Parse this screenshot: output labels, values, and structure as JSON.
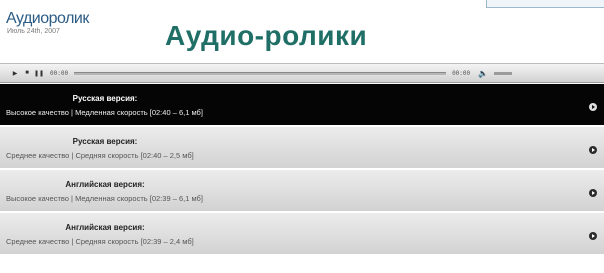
{
  "brand": {
    "title": "Аудиоролик",
    "subtitle": "Июль 24th, 2007"
  },
  "page_title": "Аудио-ролики",
  "player": {
    "time_current": "00:00",
    "time_total": "00:00",
    "icons": [
      "play-icon",
      "stop-icon",
      "pause-icon",
      "volume-icon"
    ]
  },
  "items": [
    {
      "name": "Русская версия:",
      "desc": "Высокое качество | Медленная скорость [02:40 – 6,1 мб]"
    },
    {
      "name": "Русская версия:",
      "desc": "Среднее качество | Средняя скорость [02:40 – 2,5 мб]"
    },
    {
      "name": "Английская версия:",
      "desc": "Высокое качество | Медленная скорость [02:39 – 6,1 мб]"
    },
    {
      "name": "Английская версия:",
      "desc": "Среднее качество | Средняя скорость [02:39 – 2,4 мб]"
    }
  ],
  "colors": {
    "accent_title": "#1f6f66",
    "brand": "#2c5c86",
    "active_row": "#050505"
  }
}
